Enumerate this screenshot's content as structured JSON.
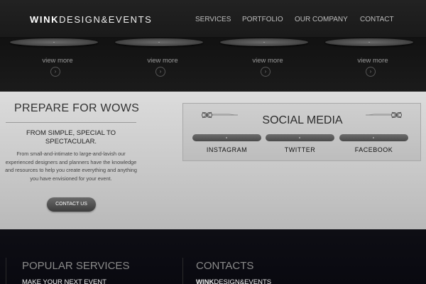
{
  "header": {
    "logo_bold": "WINK",
    "logo_rest": "DESIGN&EVENTS",
    "nav": [
      "SERVICES",
      "PORTFOLIO",
      "OUR COMPANY",
      "CONTACT"
    ]
  },
  "strip": {
    "items": [
      {
        "label": "view more",
        "icon": "chevron-right-icon"
      },
      {
        "label": "view more",
        "icon": "chevron-right-icon"
      },
      {
        "label": "view more",
        "icon": "chevron-right-icon"
      },
      {
        "label": "view more",
        "icon": "chevron-right-icon"
      }
    ]
  },
  "prepare": {
    "title": "PREPARE FOR WOWS",
    "subtitle": "FROM SIMPLE, SPECIAL TO SPECTACULAR.",
    "body": "From small-and-intimate to large-and-lavish our experienced designers and planners have the knowledge and resources to help you create everything and anything you have envisioned for your event.",
    "button": "CONTACT US"
  },
  "social": {
    "title": "SOCIAL MEDIA",
    "links": [
      "INSTAGRAM",
      "TWITTER",
      "FACEBOOK"
    ]
  },
  "footer": {
    "services_title": "POPULAR SERVICES",
    "services_first": "MAKE YOUR NEXT EVENT",
    "contacts_title": "CONTACTS",
    "contacts_bold": "WINK",
    "contacts_rest": "DESIGN&EVENTS"
  },
  "colors": {
    "header_bg": "#1e1e1e",
    "middle_bg": "#cfcfcf",
    "footer_bg": "#0b0b10",
    "button_bg": "#4a4a4a"
  }
}
